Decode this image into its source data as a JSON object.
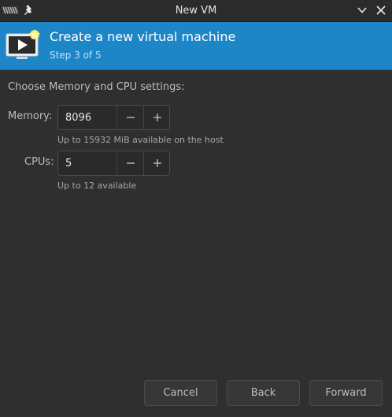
{
  "window": {
    "title": "New VM"
  },
  "header": {
    "title": "Create a new virtual machine",
    "step": "Step 3 of 5",
    "icon": "vm-monitor-star-icon"
  },
  "section": {
    "heading": "Choose Memory and CPU settings:"
  },
  "memory": {
    "label": "Memory:",
    "value": "8096",
    "hint": "Up to 15932 MiB available on the host"
  },
  "cpus": {
    "label": "CPUs:",
    "value": "5",
    "hint": "Up to 12 available"
  },
  "buttons": {
    "cancel": "Cancel",
    "back": "Back",
    "forward": "Forward"
  },
  "colors": {
    "banner": "#1d86c7",
    "background": "#2f2f2f",
    "titlebar": "#2b2b2b"
  }
}
